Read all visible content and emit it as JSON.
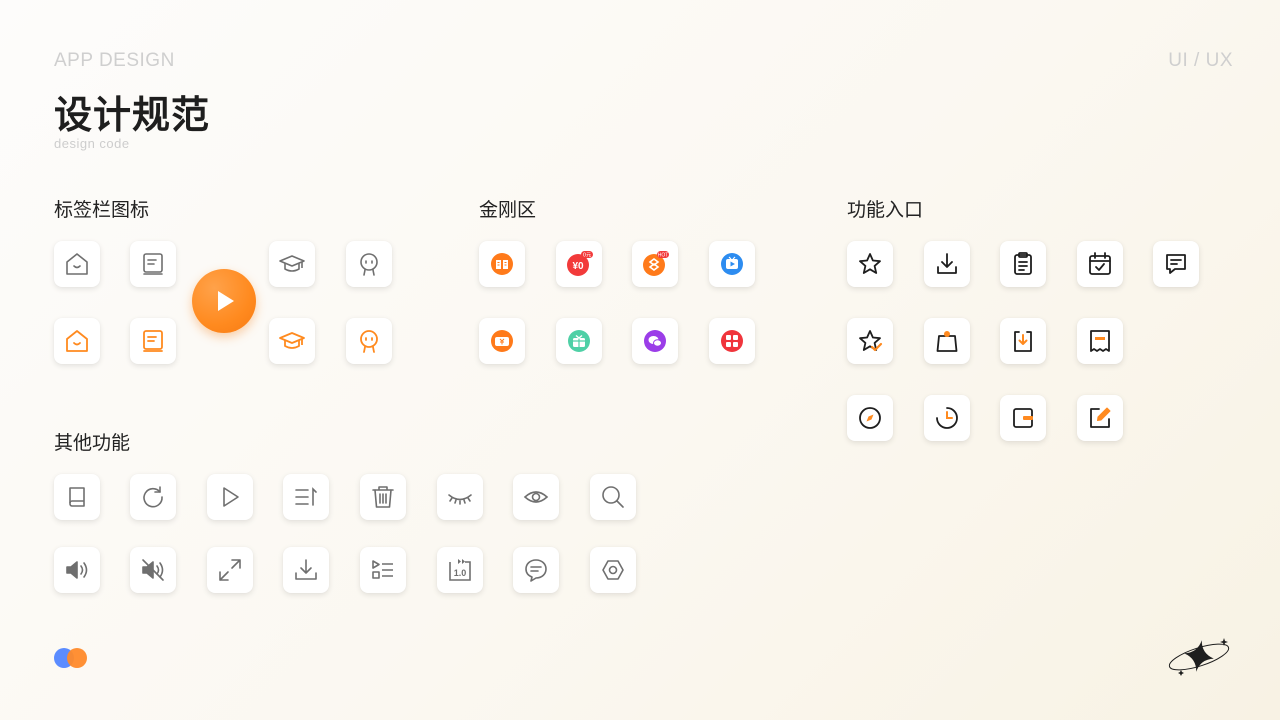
{
  "header": {
    "eyebrow": "APP DESIGN",
    "corner": "UI / UX",
    "title": "设计规范",
    "subtitle": "design code"
  },
  "sections": {
    "tab_bar": "标签栏图标",
    "king_kong": "金刚区",
    "function_entry": "功能入口",
    "other": "其他功能"
  },
  "badges": {
    "zero_yuan": "0元",
    "hot": "HOT",
    "yen_zero": "¥0",
    "speed": "1.0"
  },
  "icons": {
    "tab_bar_gray": [
      "home-icon",
      "book-icon",
      "graduation-cap-icon",
      "avatar-face-icon"
    ],
    "tab_bar_orange": [
      "home-icon",
      "book-icon",
      "graduation-cap-icon",
      "avatar-face-icon"
    ],
    "king_kong": [
      "book-reading-icon",
      "zero-yuan-icon",
      "s-hot-icon",
      "tv-play-icon",
      "coupon-yen-icon",
      "gift-icon",
      "chat-bubble-icon",
      "grid-apps-icon"
    ],
    "function_entry": [
      "star-icon",
      "download-icon",
      "clipboard-icon",
      "calendar-check-icon",
      "message-icon",
      "star-check-icon",
      "bag-icon",
      "download-box-icon",
      "receipt-icon",
      "compass-icon",
      "clock-icon",
      "wallet-icon",
      "edit-icon"
    ],
    "other": [
      "book-icon",
      "refresh-icon",
      "play-icon",
      "sort-list-icon",
      "trash-icon",
      "eye-closed-icon",
      "eye-icon",
      "search-icon",
      "volume-icon",
      "mute-icon",
      "fullscreen-icon",
      "download-icon",
      "playlist-icon",
      "speed-icon",
      "comment-icon",
      "settings-hex-icon"
    ]
  },
  "colors": {
    "accent": "#ff8a1f",
    "gray_icon": "#6f6f6f",
    "dot_blue": "#5b8cff",
    "dot_orange": "#ff8a2a"
  }
}
